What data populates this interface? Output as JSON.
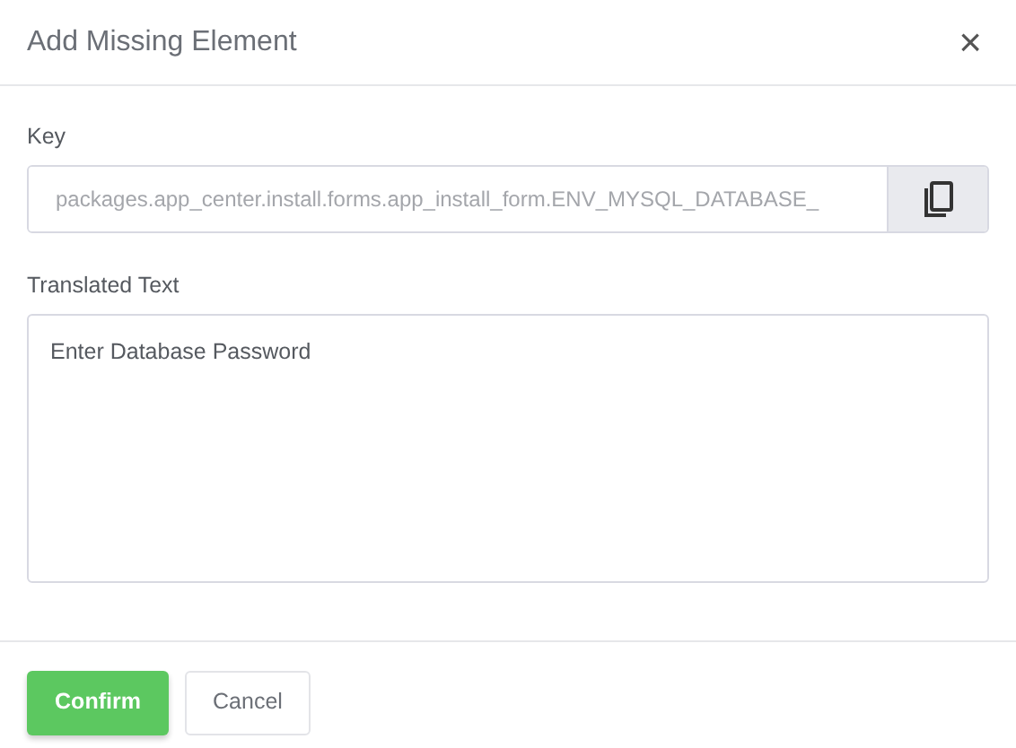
{
  "dialog": {
    "title": "Add Missing Element",
    "close": "×"
  },
  "key": {
    "label": "Key",
    "value": "packages.app_center.install.forms.app_install_form.ENV_MYSQL_DATABASE_"
  },
  "translated": {
    "label": "Translated Text",
    "value": "Enter Database Password"
  },
  "buttons": [
    {
      "label": "Confirm",
      "kind": "primary"
    },
    {
      "label": "Cancel",
      "kind": "secondary"
    }
  ]
}
